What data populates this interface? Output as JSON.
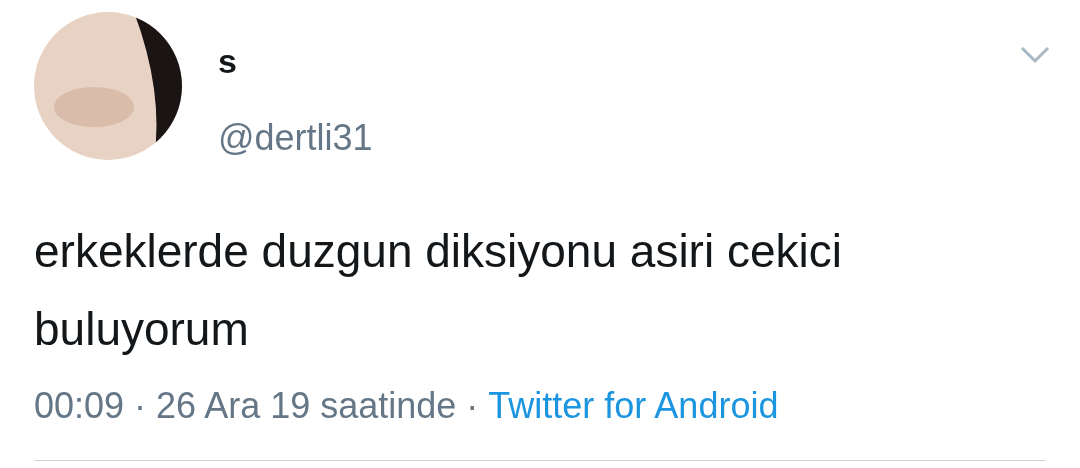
{
  "author": {
    "name": "s",
    "handle": "@dertli31"
  },
  "tweet": {
    "text": "erkeklerde duzgun diksiyonu asiri cekici buluyorum",
    "timestamp": "00:09 · 26 Ara 19 saatinde ·",
    "source": "Twitter for Android"
  }
}
